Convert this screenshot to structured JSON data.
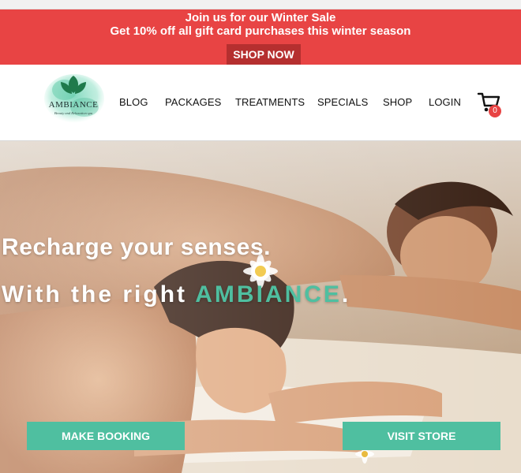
{
  "promo": {
    "line1": "Join us for our Winter Sale",
    "line2": "Get 10% off all gift card purchases this winter season",
    "cta": "SHOP NOW"
  },
  "brand": {
    "logo_text": "AMBIANCE",
    "tagline": "Beauty and Relaxation spa"
  },
  "nav": {
    "items": [
      "BLOG",
      "PACKAGES",
      "TREATMENTS",
      "SPECIALS",
      "SHOP",
      "LOGIN"
    ]
  },
  "cart": {
    "count": "0",
    "icon": "shopping-cart-icon"
  },
  "hero": {
    "headline": "Recharge your senses.",
    "subline_prefix": "With the right ",
    "subline_accent": "AMBIANCE",
    "subline_suffix": ".",
    "buttons": {
      "booking": "MAKE BOOKING",
      "store": "VISIT STORE"
    }
  },
  "colors": {
    "promo_red": "#e84444",
    "accent_teal": "#4fbfa0",
    "shop_now_bg": "#b52f2f"
  }
}
